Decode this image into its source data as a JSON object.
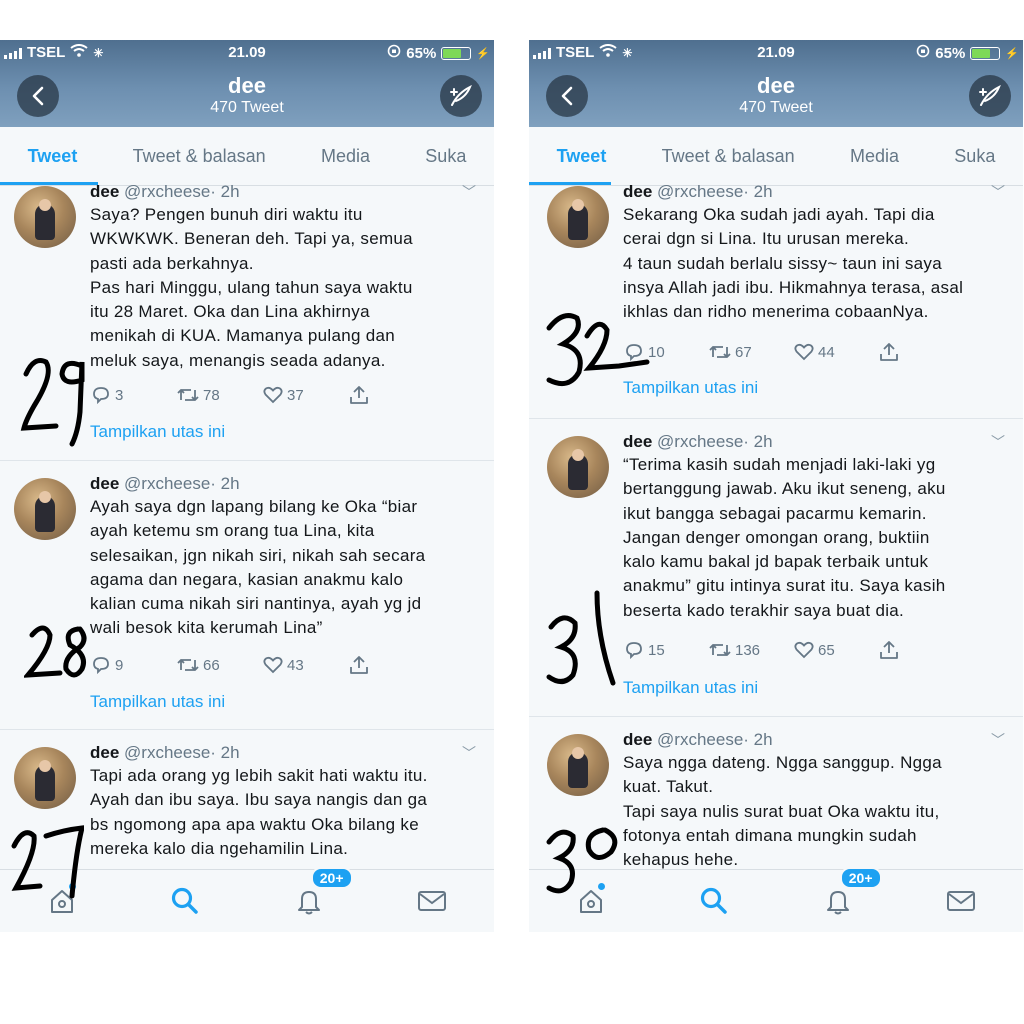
{
  "status": {
    "carrier": "TSEL",
    "time": "21.09",
    "battery": "65%",
    "battery_level": 0.65
  },
  "profile": {
    "name": "dee",
    "tweet_count": "470 Tweet"
  },
  "tabs": [
    "Tweet",
    "Tweet & balasan",
    "Media",
    "Suka"
  ],
  "show_thread": "Tampilkan utas ini",
  "badge": "20+",
  "icons": {
    "back": "back-arrow-icon",
    "compose": "compose-feather-icon",
    "reply": "reply-icon",
    "retweet": "retweet-icon",
    "like": "heart-icon",
    "share": "share-icon",
    "home": "home-icon",
    "search": "search-icon",
    "notifications": "bell-icon",
    "messages": "mail-icon"
  },
  "colors": {
    "accent": "#1da1f2",
    "header": "#6d8fb0",
    "text": "#14171a",
    "muted": "#657786"
  },
  "left": {
    "tweets": [
      {
        "name": "dee",
        "handle": "@rxcheese",
        "time": "· 2h",
        "lines": [
          "Saya? Pengen bunuh diri waktu itu",
          "WKWKWK. Beneran deh. Tapi ya, semua",
          "pasti ada berkahnya.",
          "Pas hari Minggu, ulang tahun saya waktu",
          "itu 28 Maret. Oka dan Lina akhirnya",
          "menikah di KUA. Mamanya pulang dan",
          "meluk saya, menangis seada adanya."
        ],
        "replies": "3",
        "retweets": "78",
        "likes": "37",
        "number": "29"
      },
      {
        "name": "dee",
        "handle": "@rxcheese",
        "time": "· 2h",
        "lines": [
          "Ayah saya dgn lapang bilang ke Oka “biar",
          "ayah ketemu sm orang tua Lina, kita",
          "selesaikan, jgn nikah siri, nikah sah secara",
          "agama dan negara, kasian anakmu kalo",
          "kalian cuma nikah siri nantinya, ayah yg jd",
          "wali besok kita kerumah Lina”"
        ],
        "replies": "9",
        "retweets": "66",
        "likes": "43",
        "number": "28"
      },
      {
        "name": "dee",
        "handle": "@rxcheese",
        "time": "· 2h",
        "lines": [
          "Tapi ada orang yg lebih sakit hati waktu itu.",
          "Ayah dan ibu saya. Ibu saya nangis dan ga",
          "bs ngomong apa apa waktu Oka bilang ke",
          "mereka kalo dia ngehamilin Lina."
        ],
        "number": "27"
      }
    ]
  },
  "right": {
    "tweets": [
      {
        "name": "dee",
        "handle": "@rxcheese",
        "time": "· 2h",
        "lines": [
          "Sekarang Oka sudah jadi ayah. Tapi dia",
          "cerai dgn si Lina. Itu urusan mereka.",
          "4 taun sudah berlalu sissy~ taun ini saya",
          "insya Allah jadi ibu. Hikmahnya terasa, asal",
          "ikhlas dan ridho menerima cobaanNya."
        ],
        "replies": "10",
        "retweets": "67",
        "likes": "44",
        "number": "32"
      },
      {
        "name": "dee",
        "handle": "@rxcheese",
        "time": "· 2h",
        "lines": [
          "“Terima kasih sudah menjadi laki-laki yg",
          "bertanggung jawab. Aku ikut seneng, aku",
          "ikut bangga sebagai pacarmu kemarin.",
          "Jangan denger omongan orang, buktiin",
          "kalo kamu bakal jd bapak terbaik untuk",
          "anakmu” gitu intinya surat itu. Saya kasih",
          "beserta kado terakhir saya buat dia."
        ],
        "replies": "15",
        "retweets": "136",
        "likes": "65",
        "number": "31"
      },
      {
        "name": "dee",
        "handle": "@rxcheese",
        "time": "· 2h",
        "lines": [
          "Saya ngga dateng. Ngga sanggup. Ngga",
          "kuat. Takut.",
          "Tapi saya nulis surat buat Oka waktu itu,",
          "fotonya entah dimana mungkin sudah",
          "kehapus hehe."
        ],
        "number": "30"
      }
    ]
  }
}
